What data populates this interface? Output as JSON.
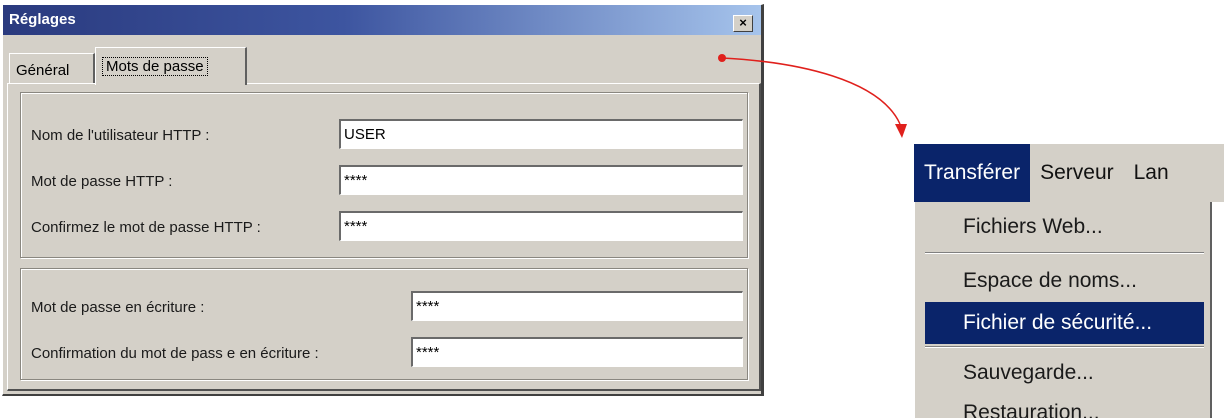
{
  "dialog": {
    "title": "Réglages",
    "close_glyph": "×",
    "tabs": [
      {
        "label": "Général"
      },
      {
        "label": "Mots de passe"
      }
    ],
    "http_group": {
      "username_label": "Nom de l'utilisateur HTTP :",
      "username_value": "USER",
      "password_label": "Mot de passe HTTP :",
      "password_value": "****",
      "confirm_label": "Confirmez le mot de passe HTTP :",
      "confirm_value": "****"
    },
    "write_group": {
      "password_label": "Mot de passe en écriture :",
      "password_value": "****",
      "confirm_label": "Confirmation du mot de pass e en écriture :",
      "confirm_value": "****"
    }
  },
  "menu": {
    "bar": [
      "Transférer",
      "Serveur",
      "Lan"
    ],
    "items": [
      "Fichiers Web...",
      "Espace de noms...",
      "Fichier de sécurité...",
      "Sauvegarde...",
      "Restauration..."
    ]
  },
  "colors": {
    "window_face": "#d4d0c8",
    "title_gradient_start": "#2a3a7e",
    "menu_highlight": "#0a246a",
    "arrow": "#e0201c"
  }
}
